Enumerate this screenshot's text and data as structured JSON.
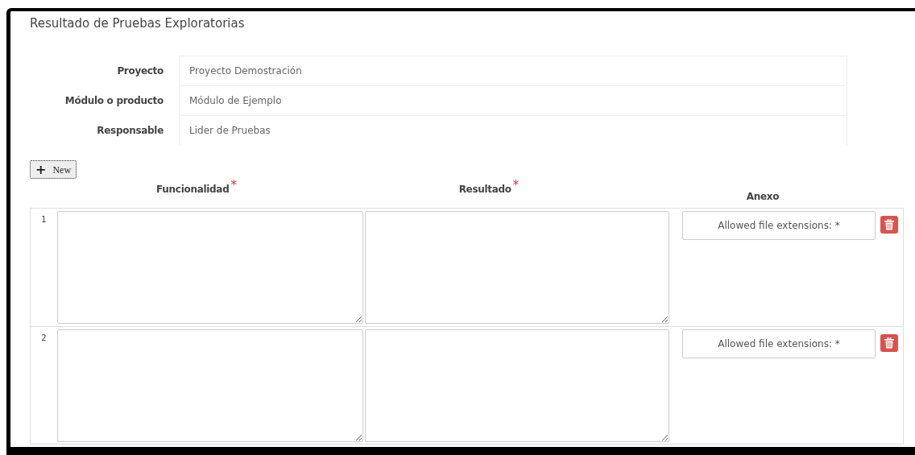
{
  "title": "Resultado de Pruebas Exploratorias",
  "fields": [
    {
      "label": "Proyecto",
      "value": "Proyecto Demostración"
    },
    {
      "label": "Módulo o producto",
      "value": "Módulo de Ejemplo"
    },
    {
      "label": "Responsable",
      "value": "Lider de Pruebas"
    }
  ],
  "new_button": {
    "icon": "+",
    "label": "New"
  },
  "columns": [
    {
      "label": "Funcionalidad",
      "required": true,
      "required_mark": "*"
    },
    {
      "label": "Resultado",
      "required": true,
      "required_mark": "*"
    },
    {
      "label": "Anexo",
      "required": false
    }
  ],
  "rows": [
    {
      "number": "1",
      "attachment": "Allowed file extensions: *"
    },
    {
      "number": "2",
      "attachment": "Allowed file extensions: *"
    }
  ]
}
